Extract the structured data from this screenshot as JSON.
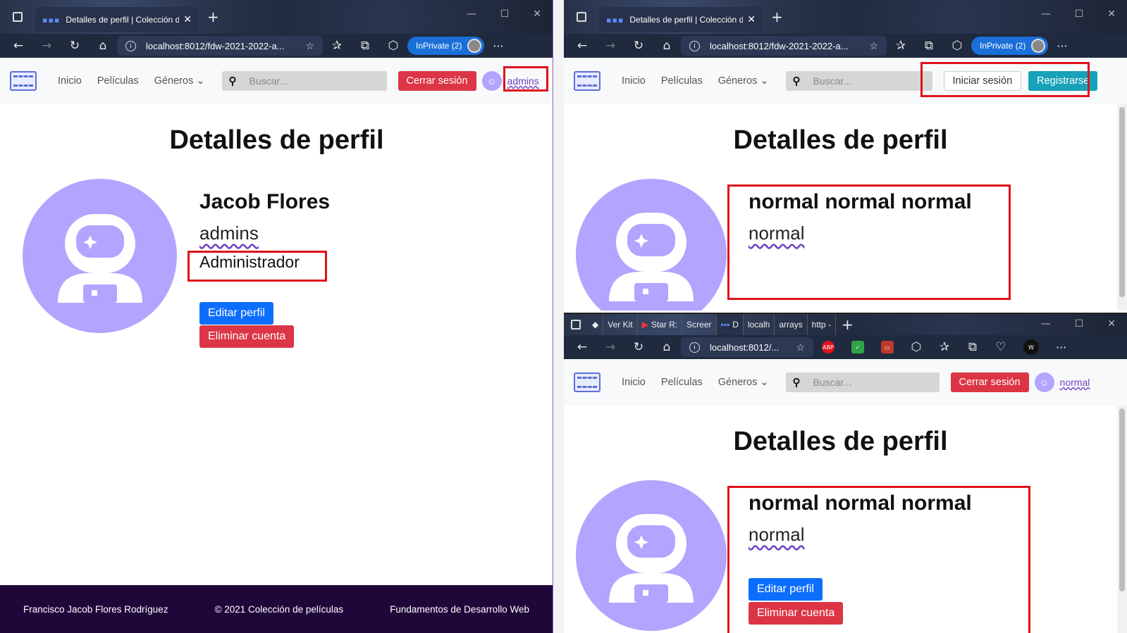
{
  "tab_title": "Detalles de perfil | Colección de",
  "url": "localhost:8012/fdw-2021-2022-a...",
  "url_short": "localhost:8012/...",
  "inprivate": "InPrivate (2)",
  "nav": {
    "home": "Inicio",
    "movies": "Películas",
    "genres": "Géneros",
    "search_placeholder": "Buscar...",
    "logout": "Cerrar sesión",
    "login": "Iniciar sesión",
    "register": "Registrarse"
  },
  "page_title": "Detalles de perfil",
  "admin_profile": {
    "name": "Jacob Flores",
    "username": "admins",
    "role": "Administrador"
  },
  "normal_profile": {
    "name": "normal normal normal",
    "username": "normal"
  },
  "buttons": {
    "edit": "Editar perfil",
    "delete": "Eliminar cuenta"
  },
  "footer": {
    "author": "Francisco Jacob Flores Rodríguez",
    "copyright": "© 2021 Colección de películas",
    "course": "Fundamentos de Desarrollo Web"
  },
  "win3_tabs": [
    "Ver Kit",
    "Star R:",
    "Screer",
    "D",
    "localh",
    "arrays",
    "http -"
  ],
  "colors": {
    "accent_purple": "#b2a4ff",
    "danger": "#dc3545",
    "primary": "#0d6efd",
    "info": "#17a2b8",
    "footer_bg": "#20073a",
    "highlight_box": "#e0121b"
  }
}
